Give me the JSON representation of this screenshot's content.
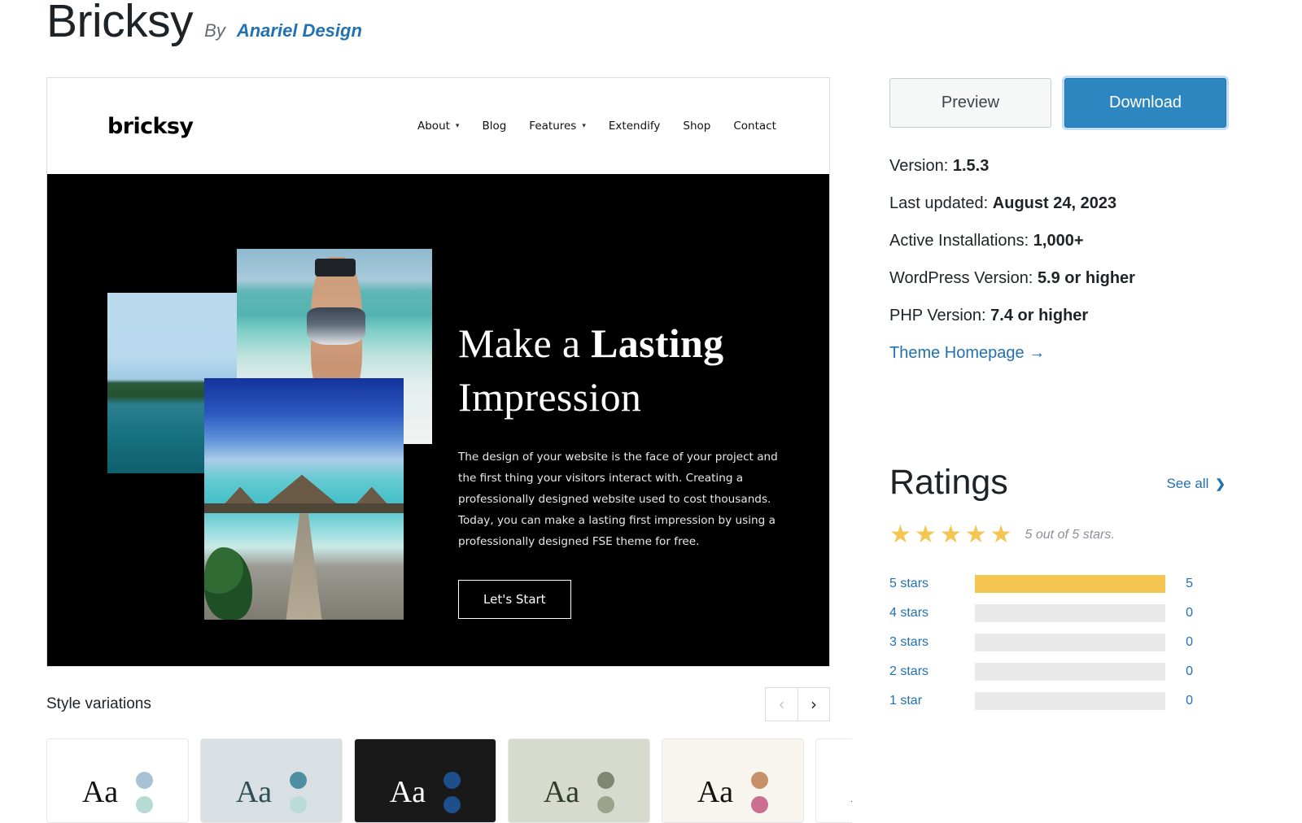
{
  "theme": {
    "name": "Bricksy",
    "by_label": "By",
    "author": "Anariel Design"
  },
  "preview": {
    "logo": "bricksy",
    "menu": [
      {
        "label": "About",
        "has_caret": true
      },
      {
        "label": "Blog",
        "has_caret": false
      },
      {
        "label": "Features",
        "has_caret": true
      },
      {
        "label": "Extendify",
        "has_caret": false
      },
      {
        "label": "Shop",
        "has_caret": false
      },
      {
        "label": "Contact",
        "has_caret": false
      }
    ],
    "caret_icon": "chevron-down-icon",
    "hero": {
      "heading_part1": "Make a ",
      "heading_bold": "Lasting",
      "heading_part2": "Impression",
      "paragraph": "The design of your website is the face of your project and the first thing your visitors interact with. Creating a professionally designed website used to cost thousands. Today, you can make a lasting first impression by using a professionally designed FSE theme for free.",
      "cta": "Let's Start"
    }
  },
  "style_variations": {
    "title": "Style variations",
    "prev_icon": "chevron-left-icon",
    "next_icon": "chevron-right-icon",
    "prev_label": "‹",
    "next_label": "›",
    "items": [
      {
        "name": "default",
        "bg": "#ffffff",
        "fg": "#111111",
        "dot1": "#a6c2d4",
        "dot2": "#b5dbd4",
        "sample": "Aa"
      },
      {
        "name": "blue-gray",
        "bg": "#d9e0e3",
        "fg": "#2f4f58",
        "dot1": "#4e8ea3",
        "dot2": "#b9dcd7",
        "sample": "Aa"
      },
      {
        "name": "dark",
        "bg": "#191919",
        "fg": "#ffffff",
        "dot1": "#1d4f8c",
        "dot2": "#1d4f8c",
        "sample": "Aa"
      },
      {
        "name": "sage",
        "bg": "#d6dbcd",
        "fg": "#2f3d28",
        "dot1": "#7d8772",
        "dot2": "#9aa48c",
        "sample": "Aa"
      },
      {
        "name": "cream",
        "bg": "#f8f5ef",
        "fg": "#111111",
        "dot1": "#c8906a",
        "dot2": "#cc6d92",
        "sample": "Aa"
      },
      {
        "name": "next-partial",
        "bg": "#ffffff",
        "fg": "#111111",
        "dot1": "#cccccc",
        "dot2": "#cccccc",
        "sample": "Aa"
      }
    ]
  },
  "actions": {
    "preview_label": "Preview",
    "download_label": "Download"
  },
  "meta": [
    {
      "label": "Version:",
      "value": "1.5.3"
    },
    {
      "label": "Last updated:",
      "value": "August 24, 2023"
    },
    {
      "label": "Active Installations:",
      "value": "1,000+"
    },
    {
      "label": "WordPress Version:",
      "value": "5.9 or higher"
    },
    {
      "label": "PHP Version:",
      "value": "7.4 or higher"
    }
  ],
  "homepage_link": "Theme Homepage  →",
  "ratings": {
    "title": "Ratings",
    "see_all": "See all",
    "see_all_chevron": "❯",
    "star_icon": "star-filled-icon",
    "stars_filled": 5,
    "summary": "5 out of 5 stars.",
    "star_glyph": "★",
    "breakdown": [
      {
        "label": "5 stars",
        "count": "5",
        "percent": 100
      },
      {
        "label": "4 stars",
        "count": "0",
        "percent": 0
      },
      {
        "label": "3 stars",
        "count": "0",
        "percent": 0
      },
      {
        "label": "2 stars",
        "count": "0",
        "percent": 0
      },
      {
        "label": "1 star",
        "count": "0",
        "percent": 0
      }
    ]
  },
  "colors": {
    "link": "#2271b1",
    "gold": "#f5c552",
    "track": "#e9e9e9",
    "download_bg": "#2e86c0"
  }
}
